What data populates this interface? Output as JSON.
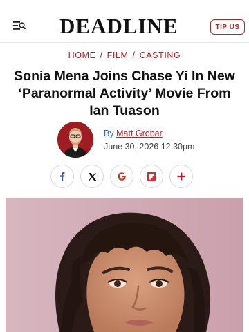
{
  "header": {
    "logo": "DEADLINE",
    "tip_label": "TIP US",
    "menu_icon": "menu-search-icon"
  },
  "breadcrumb": [
    "HOME",
    "FILM",
    "CASTING"
  ],
  "breadcrumb_sep": "/",
  "article": {
    "headline": "Sonia Mena Joins Chase Yi In New ‘Paranormal Activity’ Movie From Ian Tuason",
    "by_prefix": "By",
    "author": "Matt Grobar",
    "date": "June 30, 2026 12:30pm"
  },
  "share": {
    "icons": [
      "facebook-icon",
      "x-icon",
      "google-icon",
      "flipboard-icon",
      "more-plus-icon"
    ]
  },
  "colors": {
    "brand_red": "#b0232a",
    "link_blue": "#2a6fb0",
    "facebook_blue": "#3b5998",
    "hero_background": "#d9b7c0"
  }
}
